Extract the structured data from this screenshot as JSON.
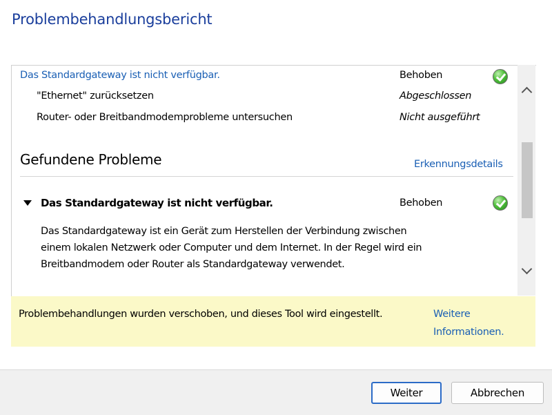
{
  "window": {
    "title": "Problembehandlungsbericht"
  },
  "report": {
    "summary_rows": [
      {
        "label": "Das Standardgateway ist nicht verfügbar.",
        "status": "Behoben",
        "icon": "green-check-icon",
        "is_link": true
      },
      {
        "label": "\"Ethernet\" zurücksetzen",
        "status": "Abgeschlossen",
        "icon": null,
        "is_link": false
      },
      {
        "label": "Router- oder Breitbandmodemprobleme untersuchen",
        "status": "Nicht ausgeführt",
        "icon": null,
        "is_link": false
      }
    ],
    "found_section": {
      "title": "Gefundene Probleme",
      "details_link": "Erkennungsdetails"
    },
    "issue": {
      "title": "Das Standardgateway ist nicht verfügbar.",
      "status": "Behoben",
      "icon": "green-check-icon",
      "description": [
        "Das Standardgateway ist ein Gerät zum Herstellen der Verbindung zwischen",
        "einem lokalen Netzwerk oder Computer und dem Internet. In der Regel wird ein",
        "Breitbandmodem oder Router als Standardgateway verwendet."
      ]
    }
  },
  "notice": {
    "text": "Problembehandlungen wurden verschoben, und dieses Tool wird eingestellt.",
    "link_line1": "Weitere",
    "link_line2": "Informationen."
  },
  "buttons": {
    "next": "Weiter",
    "cancel": "Abbrechen"
  },
  "colors": {
    "title": "#1a3e9c",
    "link": "#1a5fb4",
    "notice_bg": "#fbf9c8",
    "footer_bg": "#f0f0f0",
    "primary_border": "#2b6bc7"
  }
}
